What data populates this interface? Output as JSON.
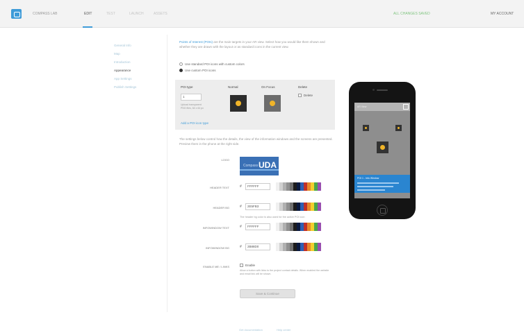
{
  "header": {
    "app_name": "COMPASS LAB",
    "tabs": [
      {
        "label": "EDIT",
        "active": true
      },
      {
        "label": "TEST",
        "active": false
      },
      {
        "label": "LAUNCH",
        "active": false
      },
      {
        "label": "ASSETS",
        "active": false
      }
    ],
    "status": "ALL CHANGES SAVED",
    "user": "MY ACCOUNT"
  },
  "sidebar": {
    "items": [
      {
        "label": "General Info",
        "active": false
      },
      {
        "label": "Map",
        "active": false
      },
      {
        "label": "Introduction",
        "active": false
      },
      {
        "label": "Appearance",
        "active": true
      },
      {
        "label": "App Settings",
        "active": false
      },
      {
        "label": "Publish Settings",
        "active": false
      }
    ]
  },
  "intro": {
    "link_text": "Points of Interest (POIs)",
    "text": " are the main targets in your AR view. Select how you would like them shown and whether they are drawn with the layout or as standard icons in the current view."
  },
  "poi_style": {
    "option_1": "Use standard POI icons with custom colors",
    "option_2": "Use custom POI icons",
    "selected": 2
  },
  "poi_panel": {
    "type_label": "POI type",
    "type_value": "1",
    "hint": "Upload transparent PNG files, 64 x 64 px",
    "normal_label": "Normal",
    "focus_label": "On Focus",
    "delete_label": "Delete",
    "delete_checkbox_label": "Delete",
    "add_link": "Add a POI icon type"
  },
  "description": "The settings below control how the details, the view of the information windows and the screens are presented. Preview them in the phone at the right side.",
  "appearance": {
    "logo_label": "LOGO",
    "logo_text_small": "Compass",
    "logo_text_big": "UDA",
    "rows": [
      {
        "label": "HEADER TEXT",
        "hex": "FFFFFF"
      },
      {
        "label": "HEADER BG",
        "hex": "2E5FB3"
      },
      {
        "label": "INFOWINDOW TEXT",
        "hex": "FFFFFF"
      },
      {
        "label": "INFOWINDOW BG",
        "hex": "2B88D0"
      }
    ],
    "bg_note": "The header bg color is also used for the active POI icon",
    "enable_label": "ENABLE ME / LINKS",
    "enable_checkbox": "Enable",
    "enable_note": "Allow a button with links to the project contact details. When enabled the website and email link will be shown.",
    "save_button": "Save & Continue",
    "palette": [
      "#f0f0f0",
      "#d0d0d0",
      "#b0b0b0",
      "#909090",
      "#707070",
      "#1c1c1c",
      "#0b1a40",
      "#2e5fb3",
      "#c0302a",
      "#e7882a",
      "#f2cf2e",
      "#4aa84a",
      "#9a4fb0"
    ]
  },
  "phone_preview": {
    "screen_title": "AR View",
    "info_title": "POI 1 - Info Window"
  },
  "footer": {
    "links": [
      "Get documentation",
      "Help center"
    ]
  },
  "colors": {
    "accent": "#3e9bd8",
    "header_bg": "#2e5fb3",
    "infowindow_bg": "#2b88d0",
    "status": "#7fc47f",
    "poi_icon": "#f0b429"
  }
}
